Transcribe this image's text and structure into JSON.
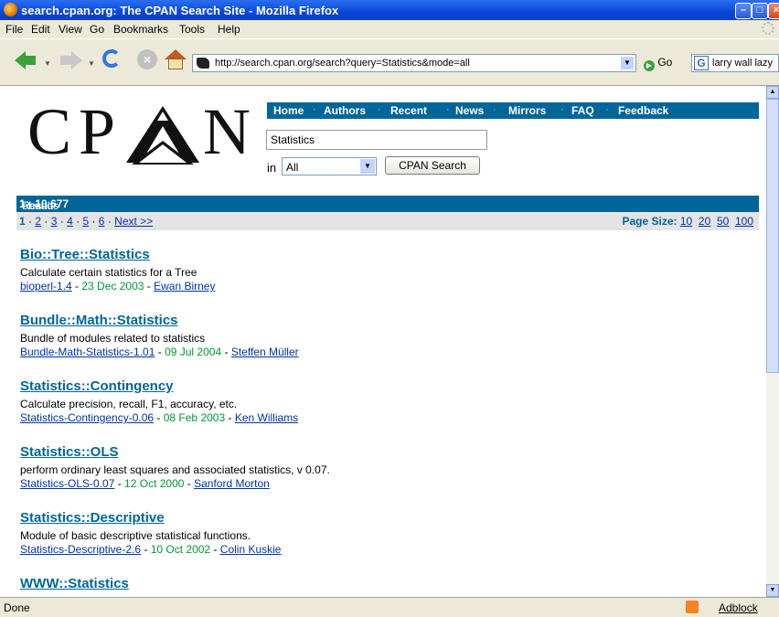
{
  "window": {
    "title": "search.cpan.org: The CPAN Search Site - Mozilla Firefox"
  },
  "menu": [
    "File",
    "Edit",
    "View",
    "Go",
    "Bookmarks",
    "Tools",
    "Help"
  ],
  "toolbar": {
    "url": "http://search.cpan.org/search?query=Statistics&mode=all",
    "go_label": "Go",
    "search_value": "larry wall lazy"
  },
  "logo": {
    "letters": [
      "C",
      "P",
      "N"
    ]
  },
  "nav": {
    "items": [
      "Home",
      "Authors",
      "Recent",
      "News",
      "Mirrors",
      "FAQ",
      "Feedback"
    ],
    "separator": "·"
  },
  "search": {
    "query": "Statistics",
    "in_label": "in",
    "mode": "All",
    "button": "CPAN Search"
  },
  "results_header": {
    "prefix": "Results",
    "from": "1",
    "dash": "-",
    "to": "10",
    "of": "of",
    "total": "677",
    "found": "Found"
  },
  "pagination": {
    "current": "1",
    "pages": [
      "2",
      "3",
      "4",
      "5",
      "6"
    ],
    "next": "Next >>",
    "page_size_label": "Page Size:",
    "page_sizes": [
      "10",
      "20",
      "50",
      "100"
    ]
  },
  "results": [
    {
      "title": "Bio::Tree::Statistics",
      "desc": "Calculate certain statistics for a Tree",
      "dist": "bioperl-1.4",
      "date": "23 Dec 2003",
      "author": "Ewan Birney"
    },
    {
      "title": "Bundle::Math::Statistics",
      "desc": "Bundle of modules related to statistics",
      "dist": "Bundle-Math-Statistics-1.01",
      "date": "09 Jul 2004",
      "author": "Steffen Müller"
    },
    {
      "title": "Statistics::Contingency",
      "desc": "Calculate precision, recall, F1, accuracy, etc.",
      "dist": "Statistics-Contingency-0.06",
      "date": "08 Feb 2003",
      "author": "Ken Williams"
    },
    {
      "title": "Statistics::OLS",
      "desc": "perform ordinary least squares and associated statistics, v 0.07.",
      "dist": "Statistics-OLS-0.07",
      "date": "12 Oct 2000",
      "author": "Sanford Morton"
    },
    {
      "title": "Statistics::Descriptive",
      "desc": "Module of basic descriptive statistical functions.",
      "dist": "Statistics-Descriptive-2.6",
      "date": "10 Oct 2002",
      "author": "Colin Kuskie"
    },
    {
      "title": "WWW::Statistics",
      "desc": "",
      "dist": "",
      "date": "",
      "author": ""
    }
  ],
  "status": {
    "text": "Done",
    "addon": "Adblock"
  }
}
